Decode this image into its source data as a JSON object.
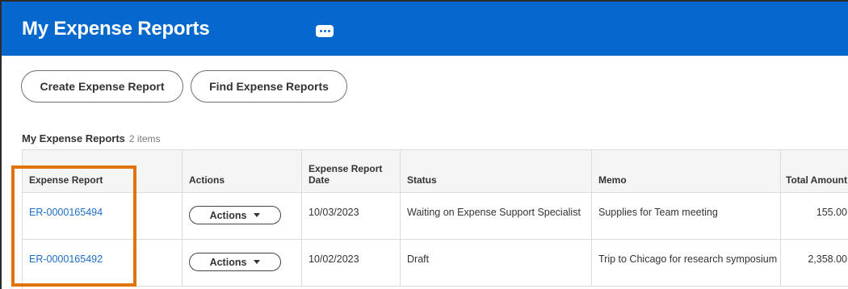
{
  "header": {
    "title": "My Expense Reports",
    "more_icon": "ellipsis-icon",
    "bg_color": "#0668cc"
  },
  "toolbar": {
    "create_label": "Create Expense Report",
    "find_label": "Find Expense Reports"
  },
  "section": {
    "title": "My Expense Reports",
    "count": "2 items"
  },
  "table": {
    "columns": {
      "expense_report": "Expense Report",
      "actions": "Actions",
      "date_line1": "Expense Report",
      "date_line2": "Date",
      "status": "Status",
      "memo": "Memo",
      "total": "Total Amount"
    },
    "rows": [
      {
        "expense_report": "ER-0000165494",
        "actions_label": "Actions",
        "date": "10/03/2023",
        "status": "Waiting on Expense Support Specialist",
        "memo": "Supplies for Team meeting",
        "total": "155.00"
      },
      {
        "expense_report": "ER-0000165492",
        "actions_label": "Actions",
        "date": "10/02/2023",
        "status": "Draft",
        "memo": "Trip to Chicago for research symposium",
        "total": "2,358.00"
      }
    ]
  },
  "annotation": {
    "highlight_color": "#e27308"
  }
}
